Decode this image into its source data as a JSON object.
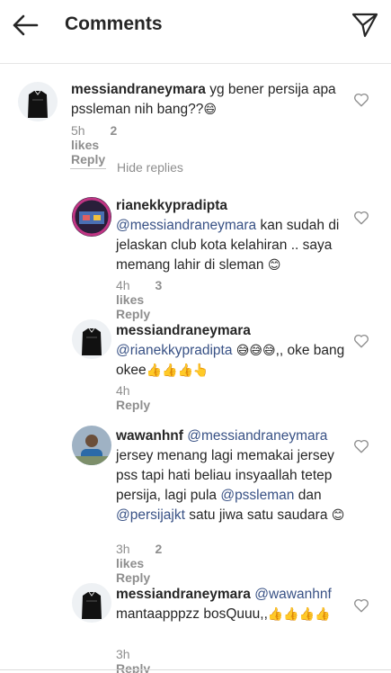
{
  "header": {
    "title": "Comments"
  },
  "hide_replies": "Hide replies",
  "comments": [
    {
      "username": "messiandraneymara",
      "parts": [
        {
          "t": "text",
          "v": " yg bener persija apa pssleman nih bang??"
        },
        {
          "t": "emoji",
          "v": "😄"
        }
      ],
      "time": "5h",
      "likes": "2 likes",
      "reply": "Reply"
    },
    {
      "username": "rianekkypradipta",
      "parts": [
        {
          "t": "mention",
          "v": "@messiandraneymara"
        },
        {
          "t": "text",
          "v": " kan sudah di jelaskan club kota kelahiran .. saya memang lahir di sleman "
        },
        {
          "t": "emoji",
          "v": "😊"
        }
      ],
      "time": "4h",
      "likes": "3 likes",
      "reply": "Reply"
    },
    {
      "username": "messiandraneymara",
      "parts": [
        {
          "t": "mention",
          "v": "@rianekkypradipta"
        },
        {
          "t": "text",
          "v": " "
        },
        {
          "t": "emoji",
          "v": "😅😅😅"
        },
        {
          "t": "text",
          "v": ",, oke bang okee"
        },
        {
          "t": "emoji",
          "v": "👍👍👍👆"
        }
      ],
      "time": "4h",
      "likes": "",
      "reply": "Reply"
    },
    {
      "username": "wawanhnf",
      "parts": [
        {
          "t": "text",
          "v": " "
        },
        {
          "t": "mention",
          "v": "@messiandraneymara"
        },
        {
          "t": "text",
          "v": " jersey menang lagi memakai jersey pss tapi hati beliau insyaallah tetep persija,  lagi pula "
        },
        {
          "t": "mention",
          "v": "@pssleman"
        },
        {
          "t": "text",
          "v": " dan "
        },
        {
          "t": "mention",
          "v": "@persijajkt"
        },
        {
          "t": "text",
          "v": " satu jiwa satu saudara "
        },
        {
          "t": "emoji",
          "v": "😊"
        }
      ],
      "time": "3h",
      "likes": "2 likes",
      "reply": "Reply"
    },
    {
      "username": "messiandraneymara",
      "parts": [
        {
          "t": "text",
          "v": " "
        },
        {
          "t": "mention",
          "v": "@wawanhnf"
        },
        {
          "t": "text",
          "v": " mantaapppzz bosQuuu,,"
        },
        {
          "t": "emoji",
          "v": "👍👍👍👍"
        }
      ],
      "time": "3h",
      "likes": "",
      "reply": "Reply"
    }
  ],
  "colors": {
    "mention": "#385185",
    "meta": "#8e8e8e",
    "text": "#262626"
  },
  "icons": [
    "back-arrow-icon",
    "send-icon",
    "heart-icon"
  ]
}
